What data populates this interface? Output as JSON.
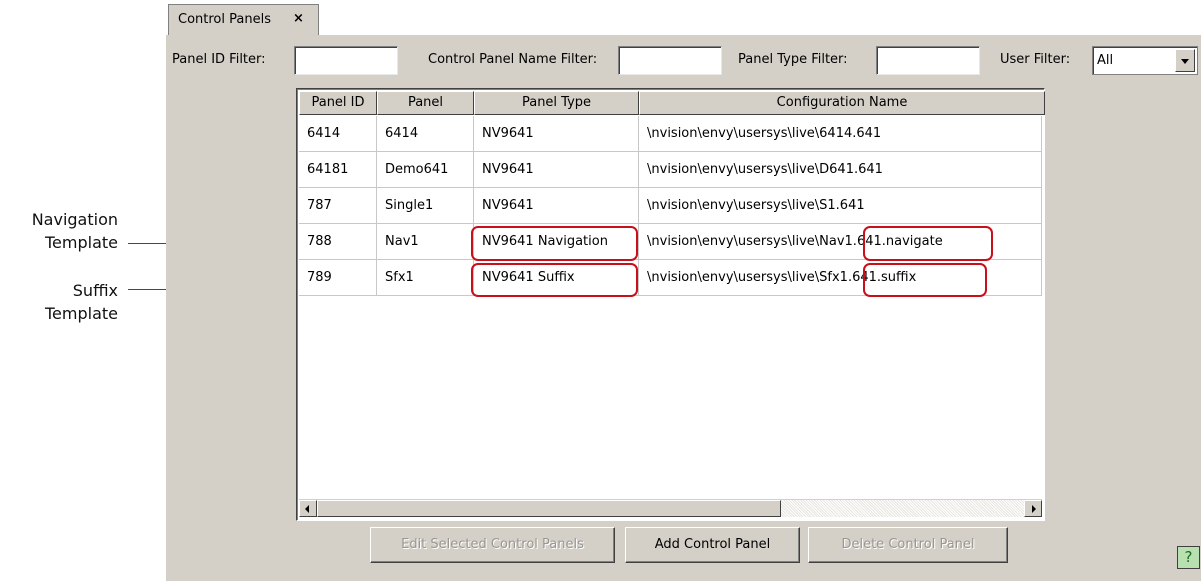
{
  "annotations": {
    "navigation_template": [
      "Navigation",
      "Template"
    ],
    "suffix_template": [
      "Suffix",
      "Template"
    ],
    "highlight_color": "#c8101a"
  },
  "tab": {
    "label": "Control Panels",
    "close_glyph": "×"
  },
  "filters": {
    "panel_id_label": "Panel ID Filter:",
    "panel_id_value": "",
    "name_label": "Control Panel Name Filter:",
    "name_value": "",
    "type_label": "Panel Type Filter:",
    "type_value": "",
    "user_label": "User Filter:",
    "user_value": "All"
  },
  "table": {
    "columns": [
      "Panel ID",
      "Panel",
      "Panel Type",
      "Configuration Name"
    ],
    "rows": [
      [
        "6414",
        "6414",
        "NV9641",
        "\\nvision\\envy\\usersys\\live\\6414.641"
      ],
      [
        "64181",
        "Demo641",
        "NV9641",
        "\\nvision\\envy\\usersys\\live\\D641.641"
      ],
      [
        "787",
        "Single1",
        "NV9641",
        "\\nvision\\envy\\usersys\\live\\S1.641"
      ],
      [
        "788",
        "Nav1",
        "NV9641 Navigation",
        "\\nvision\\envy\\usersys\\live\\Nav1.641.navigate"
      ],
      [
        "789",
        "Sfx1",
        "NV9641 Suffix",
        "\\nvision\\envy\\usersys\\live\\Sfx1.641.suffix"
      ]
    ]
  },
  "buttons": {
    "edit": "Edit Selected Control Panels",
    "add": "Add Control Panel",
    "delete": "Delete Control Panel",
    "help": "?"
  },
  "icons": {
    "tab_close": "close-icon",
    "dropdown": "chevron-down-icon",
    "scroll_left": "arrow-left-icon",
    "scroll_right": "arrow-right-icon",
    "help": "help-icon"
  }
}
